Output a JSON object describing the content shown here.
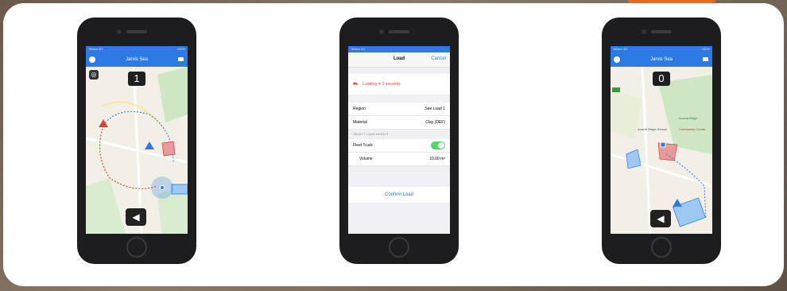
{
  "phones": [
    {
      "nav_title": "Jarvis Sea",
      "counter": "1",
      "status_left": "Telstra 4G",
      "status_right": "100%"
    },
    {
      "header_title": "Load",
      "cancel_label": "Cancel",
      "status_left": "Telstra 4G",
      "status_right": "100%",
      "warning_text": "Loading in 3 seconds",
      "rows": [
        {
          "label": "Region",
          "value": "See Load 1"
        },
        {
          "label": "Material",
          "value": "Clay (DEF)"
        }
      ],
      "section_label": "SELECT LOAD WEIGHT",
      "truck_label": "Fleet Truck",
      "volume_label": "Volume",
      "volume_value": "10.00 m³",
      "confirm_label": "Confirm Load"
    },
    {
      "nav_title": "Jarvis Sea",
      "counter": "0",
      "status_left": "Telstra 4G",
      "status_right": "100%",
      "map_labels": [
        "Acacia Ridge School",
        "Acacia Ridge",
        "Community Centre"
      ]
    }
  ],
  "colors": {
    "ios_blue": "#2c7be5",
    "accent_red": "#d9443a",
    "toggle_green": "#4cd964"
  },
  "icons": [
    "settings-icon",
    "menu-icon",
    "gps-target-icon",
    "unload-truck-icon",
    "truck-marker-icon"
  ]
}
